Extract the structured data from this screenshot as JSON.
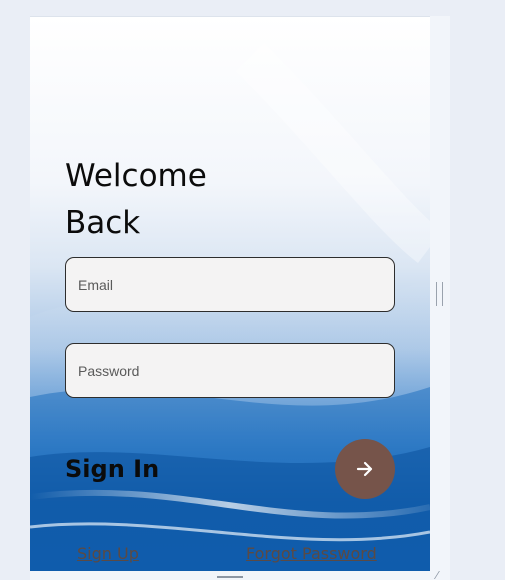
{
  "login": {
    "title_line1": "Welcome",
    "title_line2": "Back",
    "email_placeholder": "Email",
    "password_placeholder": "Password",
    "signin_label": "Sign In",
    "signup_link": "Sign Up",
    "forgot_link": "Forgot Password",
    "submit_icon": "arrow-right-icon"
  },
  "colors": {
    "accent_button": "#76544a",
    "field_background": "#f4f3f3",
    "page_background": "#eaeef6"
  }
}
